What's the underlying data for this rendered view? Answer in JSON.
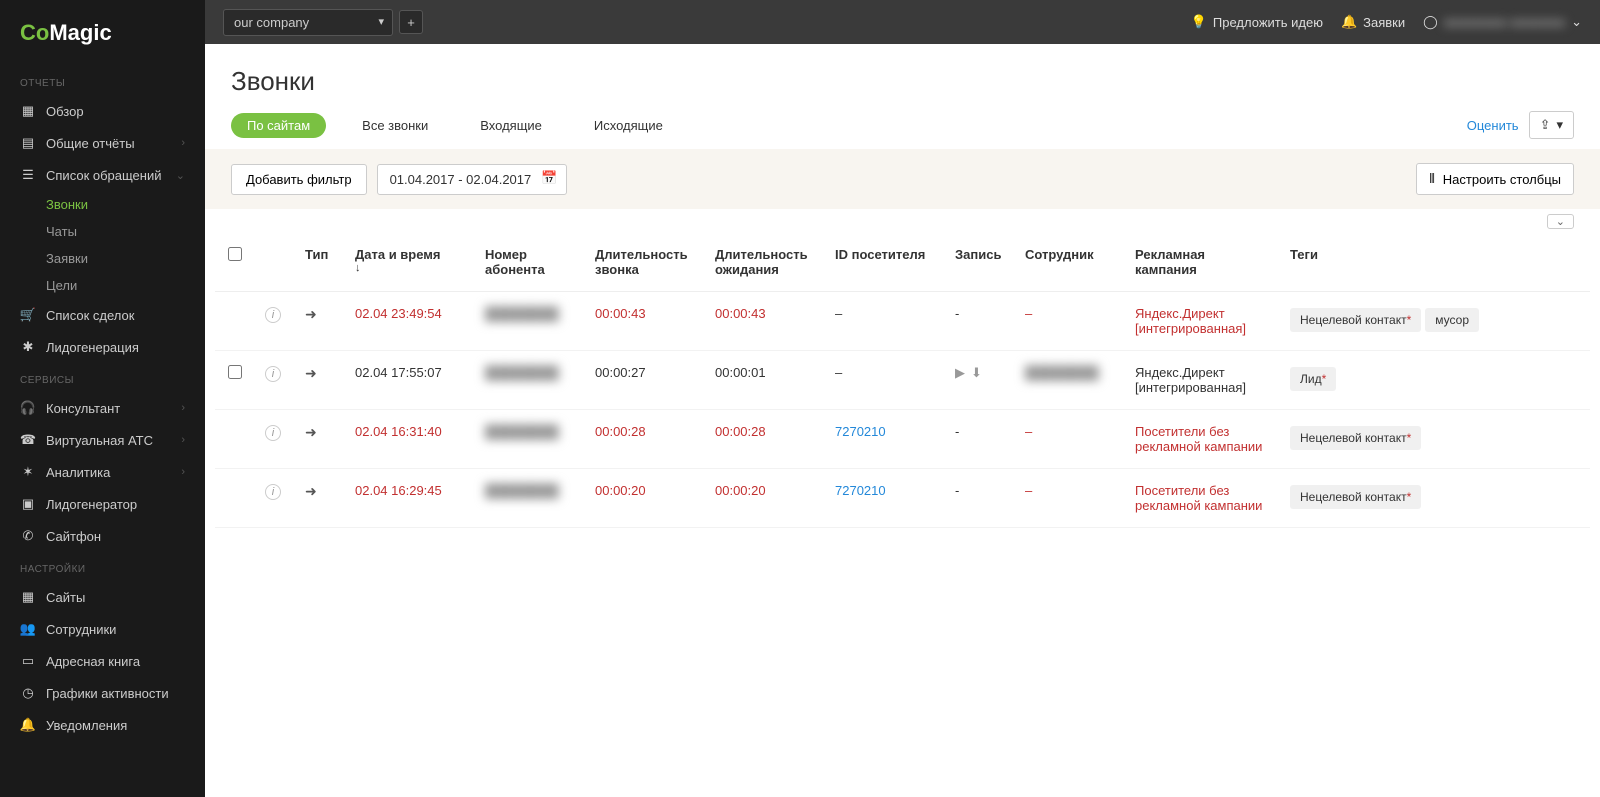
{
  "brand": {
    "co": "Co",
    "magic": "Magic"
  },
  "sidebar": {
    "sections": {
      "reports": "ОТЧЕТЫ",
      "services": "СЕРВИСЫ",
      "settings": "НАСТРОЙКИ"
    },
    "items": {
      "overview": "Обзор",
      "general_reports": "Общие отчёты",
      "request_list": "Список обращений",
      "calls": "Звонки",
      "chats": "Чаты",
      "requests": "Заявки",
      "goals": "Цели",
      "deals": "Список сделок",
      "leadgen": "Лидогенерация",
      "consultant": "Консультант",
      "virtual_pbx": "Виртуальная АТС",
      "analytics": "Аналитика",
      "lead_generator": "Лидогенератор",
      "sitephone": "Сайтфон",
      "sites": "Сайты",
      "employees": "Сотрудники",
      "address_book": "Адресная книга",
      "activity_schedules": "Графики активности",
      "notifications": "Уведомления"
    }
  },
  "topbar": {
    "company": "our company",
    "suggest_idea": "Предложить идею",
    "requests": "Заявки",
    "user_masked": "■■■■■■■■ ■■■■■■■"
  },
  "page": {
    "title": "Звонки",
    "tabs": {
      "by_sites": "По сайтам",
      "all_calls": "Все звонки",
      "incoming": "Входящие",
      "outgoing": "Исходящие"
    },
    "rate": "Оценить"
  },
  "filters": {
    "add_filter": "Добавить фильтр",
    "date_range": "01.04.2017 - 02.04.2017",
    "configure_columns": "Настроить столбцы"
  },
  "table": {
    "headers": {
      "type": "Тип",
      "datetime": "Дата и время",
      "caller_number": "Номер абонента",
      "call_duration": "Длительность звонка",
      "wait_duration": "Длительность ожидания",
      "visitor_id": "ID посетителя",
      "recording": "Запись",
      "employee": "Сотрудник",
      "campaign": "Рекламная кампания",
      "tags": "Теги"
    },
    "rows": [
      {
        "has_checkbox": false,
        "datetime": "02.04 23:49:54",
        "number_masked": "████████",
        "call_duration": "00:00:43",
        "wait_duration": "00:00:43",
        "visitor_id": "–",
        "visitor_link": false,
        "recording": "-",
        "has_play": false,
        "employee": "–",
        "employee_masked": false,
        "campaign": "Яндекс.Директ [интегрированная]",
        "red_row": true,
        "tags": [
          {
            "text": "Нецелевой контакт",
            "star": true
          },
          {
            "text": "мусор",
            "star": false
          }
        ]
      },
      {
        "has_checkbox": true,
        "datetime": "02.04 17:55:07",
        "number_masked": "████████",
        "call_duration": "00:00:27",
        "wait_duration": "00:00:01",
        "visitor_id": "–",
        "visitor_link": false,
        "recording": "",
        "has_play": true,
        "employee": "████████",
        "employee_masked": true,
        "campaign": "Яндекс.Директ [интегрированная]",
        "red_row": false,
        "tags": [
          {
            "text": "Лид",
            "star": true
          }
        ]
      },
      {
        "has_checkbox": false,
        "datetime": "02.04 16:31:40",
        "number_masked": "████████",
        "call_duration": "00:00:28",
        "wait_duration": "00:00:28",
        "visitor_id": "7270210",
        "visitor_link": true,
        "recording": "-",
        "has_play": false,
        "employee": "–",
        "employee_masked": false,
        "campaign": "Посетители без рекламной кампании",
        "red_row": true,
        "tags": [
          {
            "text": "Нецелевой контакт",
            "star": true
          }
        ]
      },
      {
        "has_checkbox": false,
        "datetime": "02.04 16:29:45",
        "number_masked": "████████",
        "call_duration": "00:00:20",
        "wait_duration": "00:00:20",
        "visitor_id": "7270210",
        "visitor_link": true,
        "recording": "-",
        "has_play": false,
        "employee": "–",
        "employee_masked": false,
        "campaign": "Посетители без рекламной кампании",
        "red_row": true,
        "tags": [
          {
            "text": "Нецелевой контакт",
            "star": true
          }
        ]
      }
    ]
  }
}
